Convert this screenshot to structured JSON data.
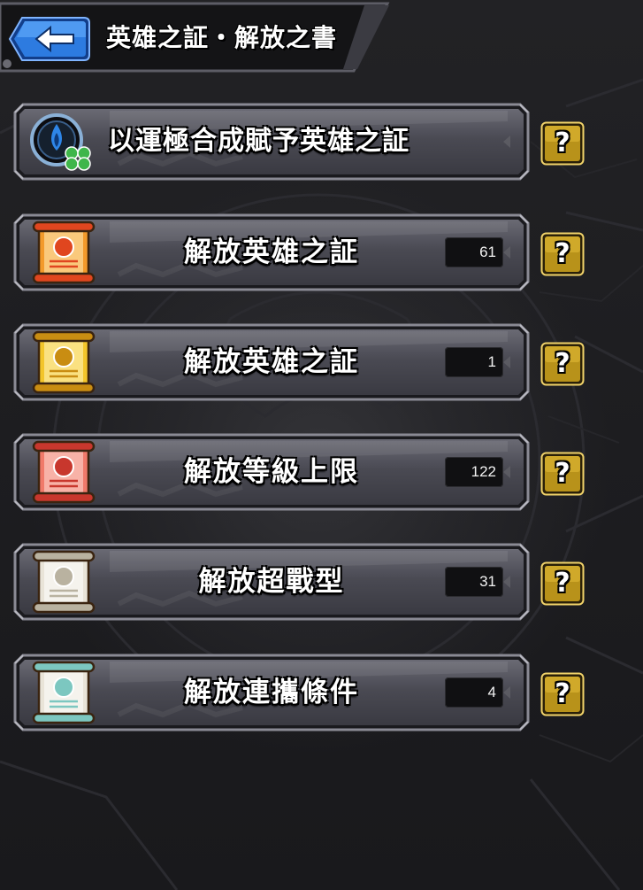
{
  "header": {
    "title": "英雄之証・解放之書",
    "back_icon": "back-arrow-icon"
  },
  "rows": [
    {
      "label": "以運極合成賦予英雄之証",
      "count": "",
      "icon": "luck-flame-clover-icon",
      "help": "?"
    },
    {
      "label": "解放英雄之証",
      "count": "61",
      "icon": "hero-scroll-orange-icon",
      "help": "?"
    },
    {
      "label": "解放英雄之証",
      "count": "1",
      "icon": "hero-scroll-gold-icon",
      "help": "?"
    },
    {
      "label": "解放等級上限",
      "count": "122",
      "icon": "level-limit-scroll-red-icon",
      "help": "?"
    },
    {
      "label": "解放超戰型",
      "count": "31",
      "icon": "super-battle-scroll-white-icon",
      "help": "?"
    },
    {
      "label": "解放連攜條件",
      "count": "4",
      "icon": "link-condition-scroll-teal-icon",
      "help": "?"
    }
  ],
  "colors": {
    "back_button": "#2f7fe0",
    "help_button": "#b8921a",
    "panel": "#4a4a52"
  }
}
